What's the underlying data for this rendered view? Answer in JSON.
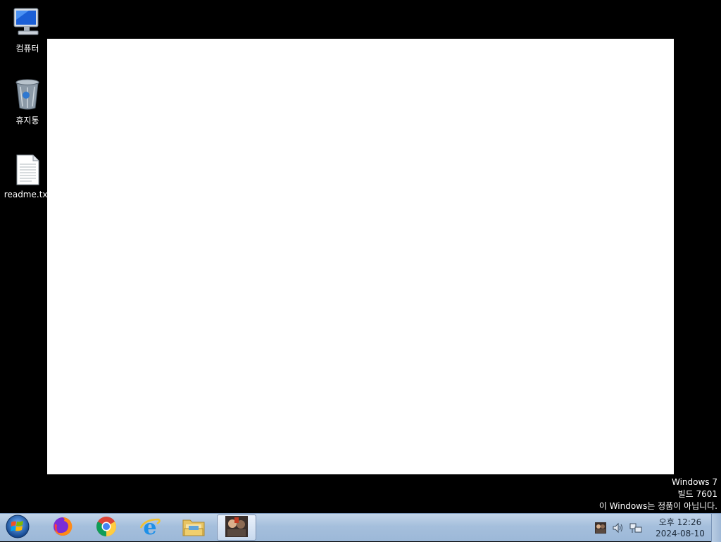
{
  "desktop": {
    "icons": [
      {
        "label": "컴퓨터",
        "icon": "computer-icon"
      },
      {
        "label": "휴지통",
        "icon": "recycle-bin-icon"
      },
      {
        "label": "readme.txt",
        "icon": "text-file-icon"
      }
    ]
  },
  "watermark": {
    "line1": "Windows 7",
    "line2": "빌드 7601",
    "line3": "이 Windows는 정품이 아닙니다."
  },
  "taskbar": {
    "start_icon": "windows-orb-icon",
    "pinned": [
      {
        "icon": "firefox-icon"
      },
      {
        "icon": "chrome-icon"
      },
      {
        "icon": "internet-explorer-icon"
      },
      {
        "icon": "file-explorer-icon"
      },
      {
        "icon": "app-thumbnail-icon",
        "active": true
      }
    ],
    "tray": {
      "icons": [
        "app-tray-icon",
        "speaker-icon",
        "network-icon"
      ],
      "time": "오후 12:26",
      "date": "2024-08-10"
    }
  },
  "colors": {
    "desktop_bg": "#000000",
    "taskbar_top": "#c3d5e9",
    "taskbar_bottom": "#9cb8d8",
    "window_bg": "#ffffff"
  }
}
